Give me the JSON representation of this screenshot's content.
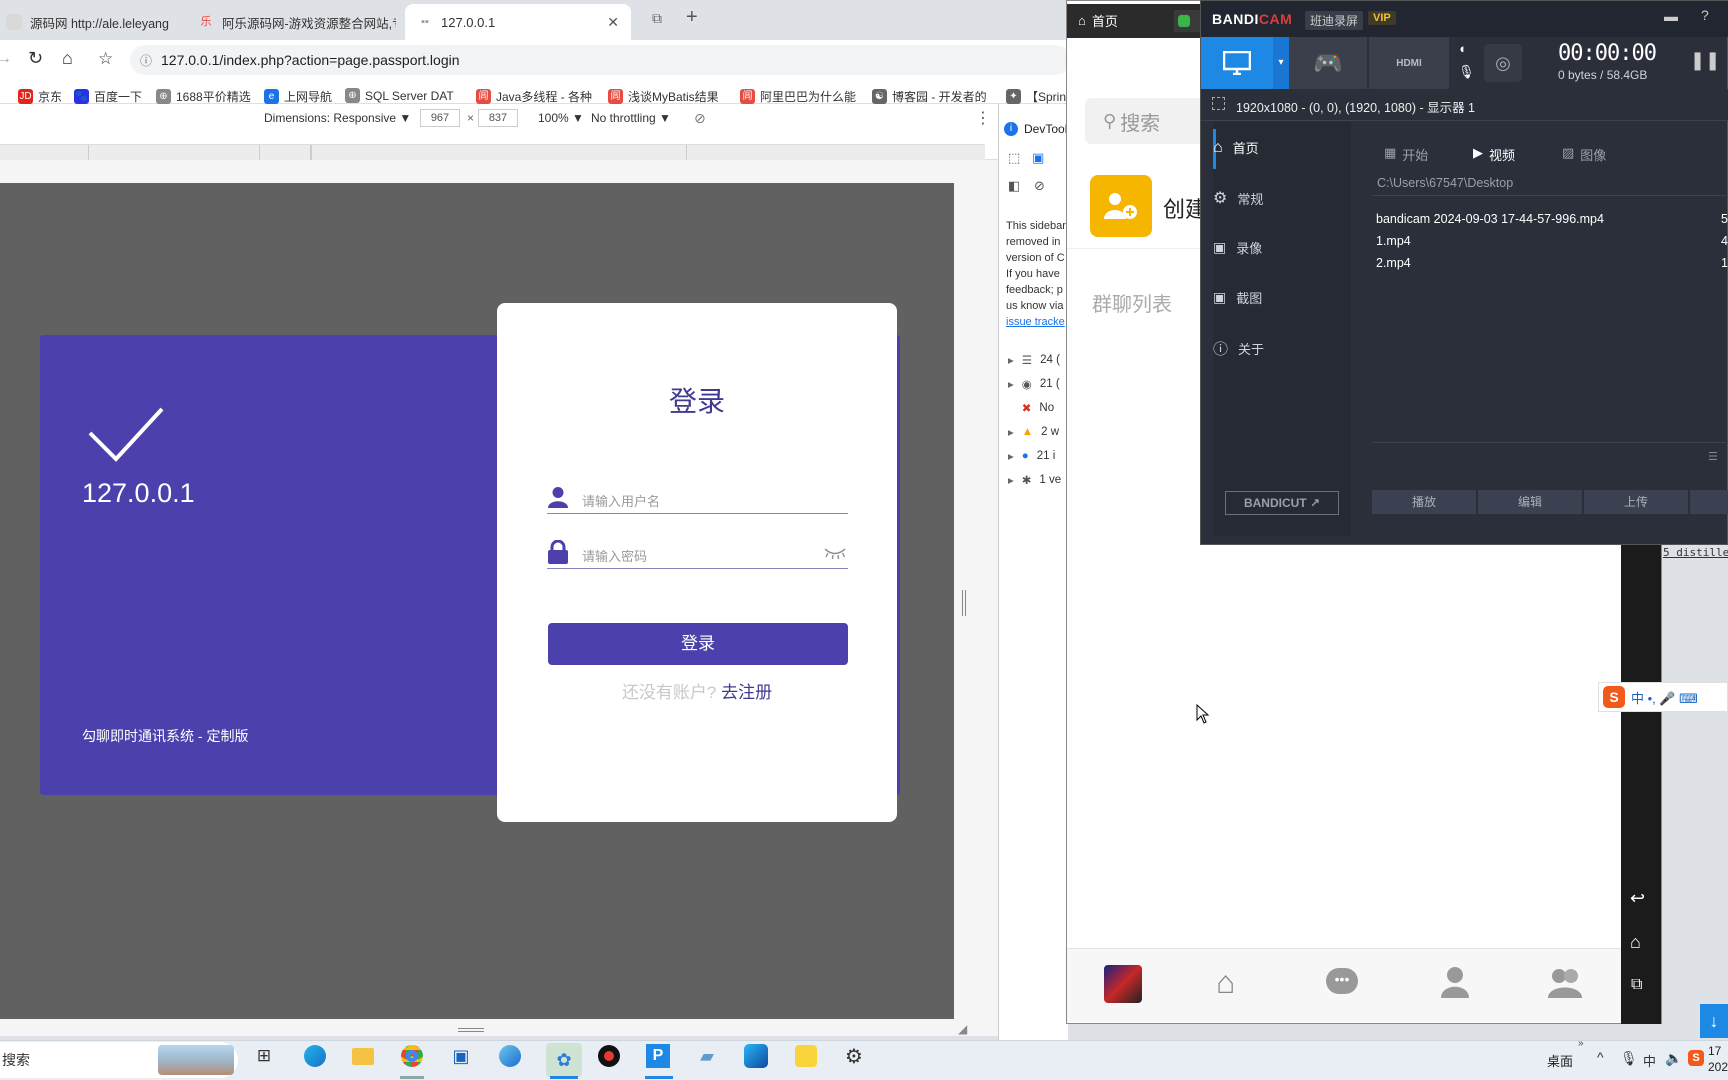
{
  "browser": {
    "tabs": [
      {
        "label": "源码网 http://ale.leleyangya",
        "icon": "globe-icon"
      },
      {
        "label": "阿乐源码网-游戏资源整合网站,专",
        "icon": "site-icon"
      },
      {
        "label": "127.0.0.1",
        "icon": "page-icon"
      }
    ],
    "url": "127.0.0.1/index.php?action=page.passport.login",
    "bookmarks": [
      {
        "label": "京东",
        "badge": "JD",
        "color": "#e1251b"
      },
      {
        "label": "百度一下",
        "badge": "🐾",
        "color": "#2932e1"
      },
      {
        "label": "1688平价精选",
        "badge": "⊕",
        "color": "#555"
      },
      {
        "label": "上网导航",
        "badge": "e",
        "color": "#1a73e8"
      },
      {
        "label": "SQL Server DAT",
        "badge": "⊕",
        "color": "#555"
      },
      {
        "label": "Java多线程 - 各种",
        "badge": "闾",
        "color": "#e54d42"
      },
      {
        "label": "浅谈MyBatis结果",
        "badge": "闾",
        "color": "#e54d42"
      },
      {
        "label": "阿里巴巴为什么能",
        "badge": "闾",
        "color": "#e54d42"
      },
      {
        "label": "博客园 - 开发者的",
        "badge": "☯",
        "color": "#444"
      },
      {
        "label": "【Sprin",
        "badge": "✦",
        "color": "#444"
      }
    ]
  },
  "devtools_toolbar": {
    "dimensions": "Dimensions: Responsive ▼",
    "width": "967",
    "times": "×",
    "height": "837",
    "zoom": "100% ▼",
    "throttle": "No throttling ▼"
  },
  "login_page": {
    "host": "127.0.0.1",
    "footer": "勾聊即时通讯系统 - 定制版",
    "title": "登录",
    "username_placeholder": "请输入用户名",
    "password_placeholder": "请输入密码",
    "submit": "登录",
    "no_account": "还没有账户?",
    "register": "去注册",
    "accent": "#4c40ac"
  },
  "devtools_panel": {
    "tab": "DevTool",
    "notice_lines": [
      "This sidebar",
      "removed in",
      "version of C",
      "If you have",
      "feedback; p",
      "us know via"
    ],
    "notice_link": "issue tracke",
    "logs": [
      {
        "icon": "list-icon",
        "text": "24 ("
      },
      {
        "icon": "user-icon",
        "text": "21 ("
      },
      {
        "icon": "error-icon",
        "text": "No"
      },
      {
        "icon": "warning-icon",
        "text": "2 w"
      },
      {
        "icon": "info-icon",
        "text": "21 i"
      },
      {
        "icon": "bug-icon",
        "text": "1 ve"
      }
    ]
  },
  "chat_app": {
    "home_tab": "首页",
    "search": "搜索",
    "create": "创建",
    "group_list": "群聊列表"
  },
  "bandicam": {
    "brand1": "BANDI",
    "brand2": "CAM",
    "subtitle": "班迪录屏",
    "vip": "VIP",
    "timer": "00:00:00",
    "size": "0 bytes / 58.4GB",
    "region": "1920x1080 - (0, 0), (1920, 1080) - 显示器 1",
    "menu": [
      "首页",
      "常规",
      "录像",
      "截图",
      "关于"
    ],
    "tabs": [
      "开始",
      "视频",
      "图像"
    ],
    "path": "C:\\Users\\67547\\Desktop",
    "files": [
      {
        "name": "bandicam 2024-09-03 17-44-57-996.mp4",
        "size": "5"
      },
      {
        "name": "1.mp4",
        "size": "4"
      },
      {
        "name": "2.mp4",
        "size": "1"
      }
    ],
    "bandicut": "BANDICUT ↗",
    "buttons": [
      "播放",
      "编辑",
      "上传"
    ]
  },
  "taskbar": {
    "search": "搜索",
    "desktop": "桌面",
    "ime": "中",
    "time": "17",
    "date": "202"
  },
  "misc": {
    "distille": "5 distille",
    "ime_bar": "中 •, 🎤 ⌨"
  }
}
